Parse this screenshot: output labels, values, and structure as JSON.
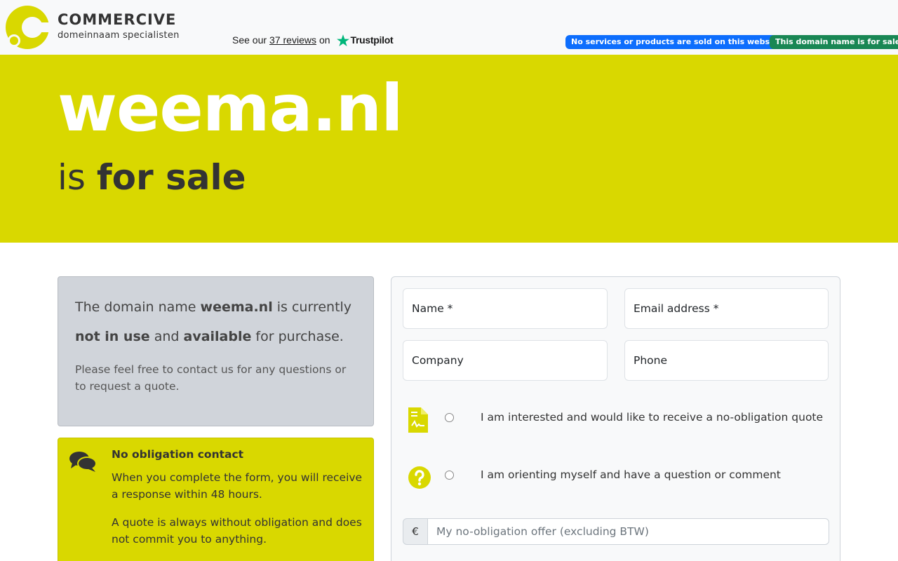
{
  "header": {
    "brand_name": "COMMERCIVE",
    "brand_tagline": "domeinnaam specialisten",
    "trustpilot": {
      "prefix": "See our",
      "reviews_link": "37 reviews",
      "suffix": "on",
      "brand": "Trustpilot"
    },
    "badges": {
      "no_services": "No services or products are sold on this website.",
      "for_sale": "This domain name is for sale"
    }
  },
  "hero": {
    "domain": "weema.nl",
    "sub_prefix": "is",
    "sub_bold": "for sale"
  },
  "info": {
    "lead_1": "The domain name",
    "domain": "weema.nl",
    "lead_2": "is currently",
    "not_in_use": "not in use",
    "lead_3": "and",
    "available": "available",
    "lead_4": "for purchase.",
    "text": "Please feel free to contact us for any questions or to request a quote."
  },
  "contact": {
    "title": "No obligation contact",
    "p1": "When you complete the form, you will receive a response within 48 hours.",
    "p2": "A quote is always without obligation and does not commit you to anything."
  },
  "form": {
    "name_placeholder": "Name *",
    "email_placeholder": "Email address *",
    "company_placeholder": "Company",
    "phone_placeholder": "Phone",
    "option_quote": "I am interested and would like to receive a no-obligation quote",
    "option_question": "I am orienting myself and have a question or comment",
    "currency": "€",
    "offer_placeholder": "My no-obligation offer (excluding BTW)"
  },
  "colors": {
    "brand_yellow": "#d9d800",
    "badge_blue": "#0d6efd",
    "badge_green": "#198754",
    "trustpilot_green": "#00b67a"
  },
  "icons": [
    "commercive-logo-icon",
    "trustpilot-star-icon",
    "chat-bubbles-icon",
    "document-icon",
    "question-circle-icon"
  ]
}
